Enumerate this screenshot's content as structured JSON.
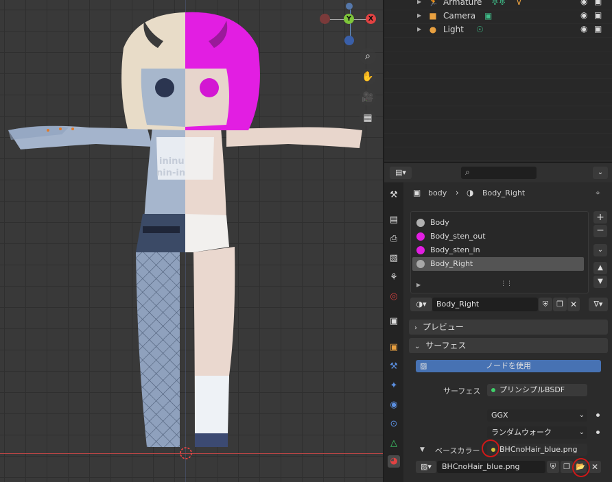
{
  "outliner": {
    "rows": [
      {
        "label": "Armature",
        "icon": "armature-icon"
      },
      {
        "label": "Camera",
        "icon": "camera-icon"
      },
      {
        "label": "Light",
        "icon": "light-icon"
      }
    ]
  },
  "viewport": {
    "gizmo": {
      "y": "Y",
      "x": "X"
    },
    "body_text_1": "ininu",
    "body_text_2": "nin-in"
  },
  "properties": {
    "breadcrumb": {
      "object": "body",
      "material": "Body_Right"
    },
    "material_slots": [
      {
        "label": "Body",
        "color": "#b0b0b0"
      },
      {
        "label": "Body_sten_out",
        "color": "#e21ee2"
      },
      {
        "label": "Body_sten_in",
        "color": "#e21ee2"
      },
      {
        "label": "Body_Right",
        "color": "#a8a8a8"
      }
    ],
    "material_name": "Body_Right",
    "panels": {
      "preview": "プレビュー",
      "surface": "サーフェス"
    },
    "use_nodes_label": "ノードを使用",
    "surface_label": "サーフェス",
    "surface_value": "プリンシプルBSDF",
    "distribution": "GGX",
    "subsurface_method": "ランダムウォーク",
    "base_color_label": "ベースカラー",
    "base_color_texture": "BHCnoHair_blue.png",
    "image_name": "BHCnoHair_blue.png"
  },
  "colors": {
    "accent_blue": "#4772b3",
    "annotation_red": "#d01818"
  }
}
